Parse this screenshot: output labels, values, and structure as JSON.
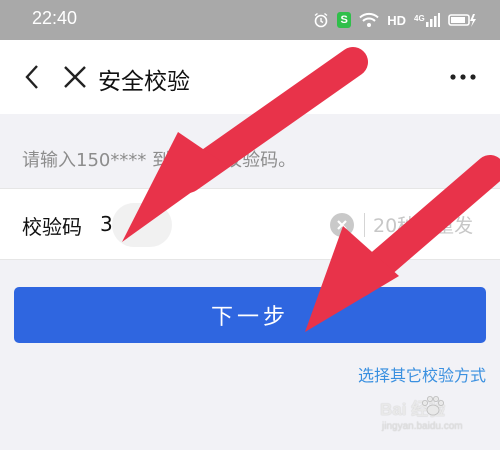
{
  "status_bar": {
    "time": "22:40",
    "badge": "S",
    "network": "HD",
    "signal_label": "4G",
    "icons": [
      "alarm-icon",
      "security-badge-icon",
      "wifi-icon",
      "signal-icon",
      "battery-icon"
    ]
  },
  "nav": {
    "title": "安全校验",
    "back_icon": "chevron-left-icon",
    "close_icon": "close-icon",
    "more_icon": "more-dots-icon"
  },
  "hint": "请输入150****             到的短信校验码。",
  "code_row": {
    "label": "校验码",
    "value": "3",
    "resend_label": "20秒后重发"
  },
  "actions": {
    "next_label": "下一步",
    "alt_link": "选择其它校验方式"
  },
  "watermark": {
    "brand": "Bai  经验",
    "url": "jingyan.baidu.com"
  },
  "colors": {
    "primary": "#2f66e0",
    "link": "#3a90e0",
    "annotation_arrow": "#e8334a",
    "status_bar": "#a9a9a9"
  }
}
